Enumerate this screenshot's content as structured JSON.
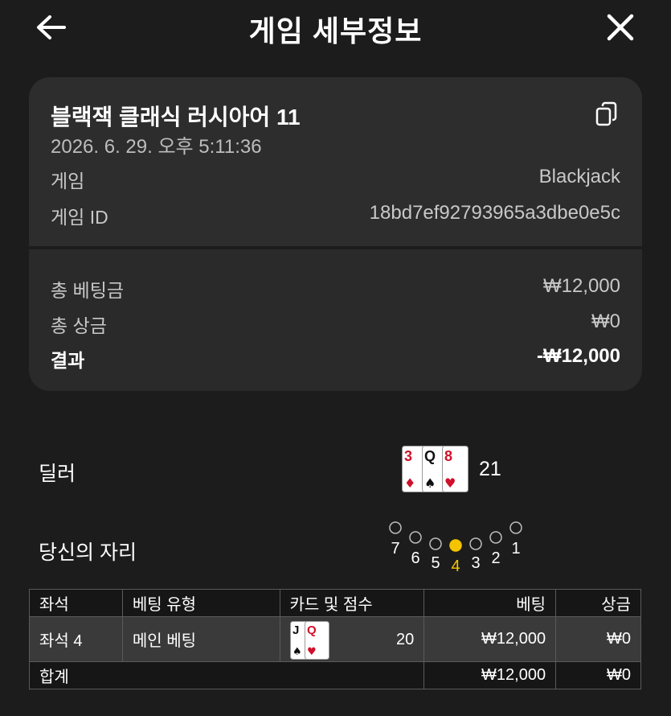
{
  "header": {
    "title": "게임 세부정보"
  },
  "game": {
    "name": "블랙잭 클래식 러시아어 11",
    "datetime": "2026. 6. 29. 오후 5:11:36",
    "game_label": "게임",
    "game_value": "Blackjack",
    "id_label": "게임 ID",
    "id_value": "18bd7ef92793965a3dbe0e5c"
  },
  "summary": {
    "total_bet_label": "총 베팅금",
    "total_bet_value": "₩12,000",
    "total_win_label": "총 상금",
    "total_win_value": "₩0",
    "result_label": "결과",
    "result_value": "-₩12,000"
  },
  "dealer": {
    "label": "딜러",
    "cards": [
      {
        "rank": "3",
        "suit": "♦",
        "color": "#d0102a"
      },
      {
        "rank": "Q",
        "suit": "♠",
        "color": "#111111"
      },
      {
        "rank": "8",
        "suit": "♥",
        "color": "#d0102a"
      }
    ],
    "score": "21"
  },
  "seat": {
    "label": "당신의 자리",
    "numbers": [
      "7",
      "6",
      "5",
      "4",
      "3",
      "2",
      "1"
    ],
    "active": "4",
    "active_color": "#f5c400"
  },
  "table": {
    "headers": [
      "좌석",
      "베팅 유형",
      "카드 및 점수",
      "베팅",
      "상금"
    ],
    "rows": [
      {
        "seat": "좌석 4",
        "bet_type": "메인 베팅",
        "cards": [
          {
            "rank": "J",
            "suit": "♠",
            "color": "#111111"
          },
          {
            "rank": "Q",
            "suit": "♥",
            "color": "#d0102a"
          }
        ],
        "score": "20",
        "bet": "₩12,000",
        "win": "₩0"
      }
    ],
    "total": {
      "label": "합계",
      "bet": "₩12,000",
      "win": "₩0"
    }
  },
  "icons": {
    "back": "arrow-left-icon",
    "close": "close-icon",
    "copy": "copy-icon"
  }
}
